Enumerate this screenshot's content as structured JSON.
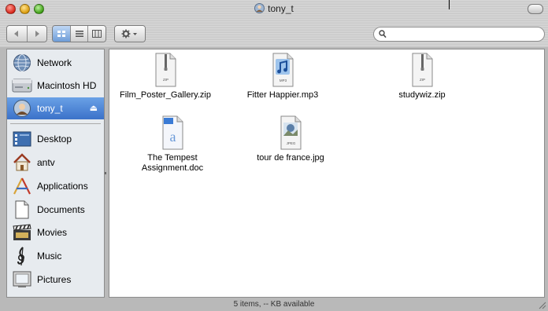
{
  "window": {
    "title": "tony_t"
  },
  "toolbar": {
    "back_label": "◀",
    "forward_label": "▶",
    "view_icons_label": "icon-view",
    "view_list_label": "list-view",
    "view_columns_label": "column-view",
    "action_label": "✲▾"
  },
  "search": {
    "value": "",
    "placeholder": ""
  },
  "sidebar": {
    "devices": [
      {
        "label": "Network",
        "icon": "network-globe-icon"
      },
      {
        "label": "Macintosh HD",
        "icon": "hard-drive-icon"
      },
      {
        "label": "tony_t",
        "icon": "user-disk-icon",
        "selected": true,
        "eject": "⏏"
      }
    ],
    "places": [
      {
        "label": "Desktop",
        "icon": "desktop-icon"
      },
      {
        "label": "antv",
        "icon": "home-icon"
      },
      {
        "label": "Applications",
        "icon": "applications-icon"
      },
      {
        "label": "Documents",
        "icon": "documents-icon"
      },
      {
        "label": "Movies",
        "icon": "movies-icon"
      },
      {
        "label": "Music",
        "icon": "music-icon"
      },
      {
        "label": "Pictures",
        "icon": "pictures-icon"
      }
    ]
  },
  "files": [
    {
      "name": "Film_Poster_Gallery.zip",
      "badge": "ZIP",
      "kind": "zip"
    },
    {
      "name": "Fitter Happier.mp3",
      "badge": "MP3",
      "kind": "mp3"
    },
    {
      "name": "studywiz.zip",
      "badge": "ZIP",
      "kind": "zip"
    },
    {
      "name": "The Tempest Assignment.doc",
      "badge": "",
      "kind": "doc"
    },
    {
      "name": "tour de france.jpg",
      "badge": "JPEG",
      "kind": "jpeg"
    }
  ],
  "status": {
    "text": "5 items, -- KB available"
  },
  "colors": {
    "selection": "#3b72c9",
    "sidebar_bg": "#e7ebef",
    "chrome": "#b9b9b9"
  }
}
